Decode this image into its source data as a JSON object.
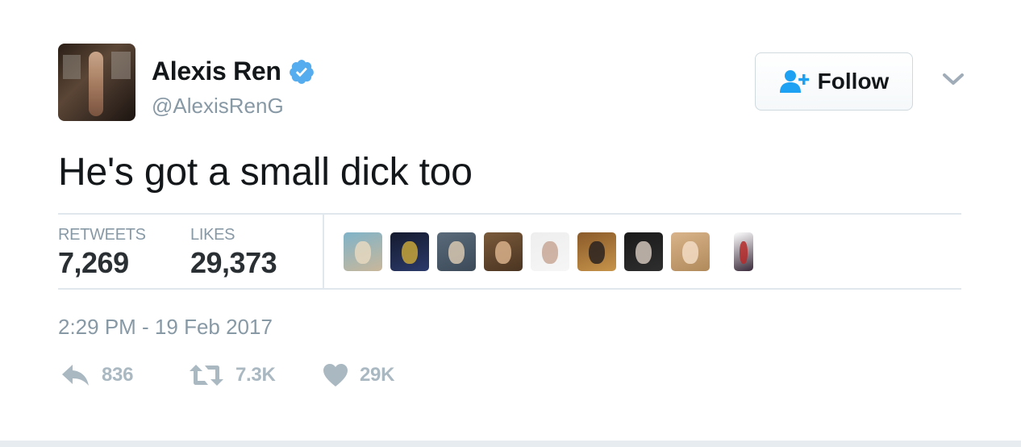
{
  "author": {
    "display_name": "Alexis Ren",
    "handle": "@AlexisRenG",
    "verified": true,
    "verified_color": "#55acee"
  },
  "follow_button": {
    "label": "Follow",
    "icon": "add-user-icon",
    "icon_color": "#1da1f2"
  },
  "menu": {
    "icon": "chevron-down-icon"
  },
  "tweet": {
    "text": "He's got a small dick too",
    "timestamp": "2:29 PM - 19 Feb 2017"
  },
  "stats": {
    "retweets_label": "RETWEETS",
    "retweets_value": "7,269",
    "likes_label": "LIKES",
    "likes_value": "29,373"
  },
  "likers": {
    "avatars": [
      {
        "colors": [
          "#7fb3c9",
          "#e6d8c0",
          "#c9b79a"
        ]
      },
      {
        "colors": [
          "#141a2e",
          "#c7a53a",
          "#2b3a6a"
        ]
      },
      {
        "colors": [
          "#5a6a7a",
          "#d7c7b0",
          "#3c4a58"
        ]
      },
      {
        "colors": [
          "#7a5a3a",
          "#d8b08a",
          "#4a3422"
        ]
      },
      {
        "colors": [
          "#eeeeee",
          "#c8a898",
          "#f6f6f6"
        ]
      },
      {
        "colors": [
          "#8a5a2a",
          "#2a2220",
          "#c7944a"
        ]
      },
      {
        "colors": [
          "#1a1a1a",
          "#cfc3b8",
          "#2e2e2e"
        ]
      },
      {
        "colors": [
          "#d9b38a",
          "#f2dcc4",
          "#b08a5a"
        ]
      },
      {
        "colors": [
          "#ffffff",
          "#b52a2a",
          "#3a2a3a"
        ]
      }
    ]
  },
  "actions": {
    "reply": {
      "icon": "reply-icon",
      "count": "836"
    },
    "retweet": {
      "icon": "retweet-icon",
      "count": "7.3K"
    },
    "like": {
      "icon": "heart-icon",
      "count": "29K"
    },
    "color": "#aab8c2"
  }
}
